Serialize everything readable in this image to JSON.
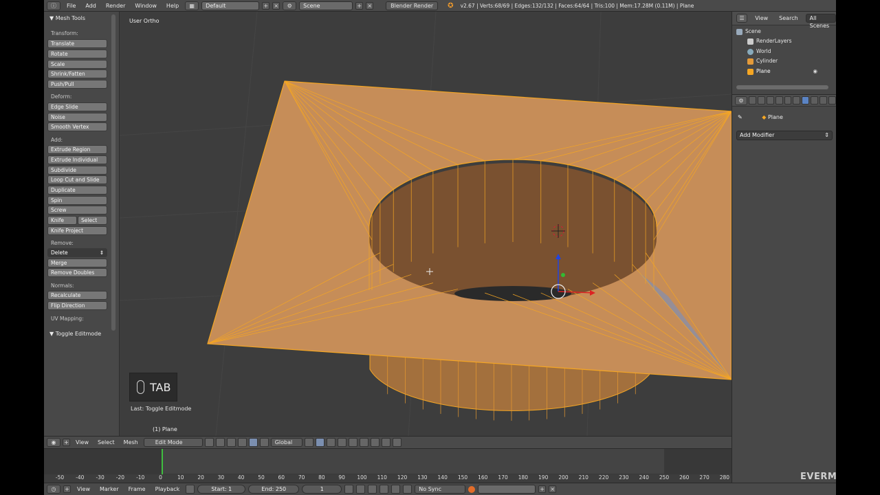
{
  "topbar": {
    "menus": [
      "File",
      "Add",
      "Render",
      "Window",
      "Help"
    ],
    "layout": "Default",
    "scene": "Scene",
    "engine": "Blender Render",
    "stats": "v2.67 | Verts:68/69 | Edges:132/132 | Faces:64/64 | Tris:100 | Mem:17.28M (0.11M) | Plane"
  },
  "toolshelf": {
    "title": "Mesh Tools",
    "sections": [
      {
        "label": "Transform:",
        "buttons": [
          "Translate",
          "Rotate",
          "Scale",
          "Shrink/Fatten",
          "Push/Pull"
        ]
      },
      {
        "label": "Deform:",
        "buttons": [
          "Edge Slide",
          "Noise",
          "Smooth Vertex"
        ]
      },
      {
        "label": "Add:",
        "buttons": [
          "Extrude Region",
          "Extrude Individual",
          "Subdivide",
          "Loop Cut and Slide",
          "Duplicate",
          "Spin",
          "Screw",
          "Knife",
          "Select",
          "Knife Project"
        ]
      },
      {
        "label": "Remove:",
        "buttons": [
          "Delete",
          "Merge",
          "Remove Doubles"
        ]
      },
      {
        "label": "Normals:",
        "buttons": [
          "Recalculate",
          "Flip Direction"
        ]
      },
      {
        "label": "UV Mapping:",
        "buttons": []
      }
    ],
    "toggle_panel": "Toggle Editmode"
  },
  "viewport": {
    "view_name": "User Ortho",
    "key_overlay": "TAB",
    "last_operator": "Last: Toggle Editmode",
    "object_label": "(1) Plane",
    "mesh_color": "#d79a60",
    "wire_color": "#f5a623"
  },
  "vp_header": {
    "menus": [
      "View",
      "Select",
      "Mesh"
    ],
    "mode": "Edit Mode",
    "orientation": "Global"
  },
  "timeline": {
    "ticks": [
      "-50",
      "-40",
      "-30",
      "-20",
      "-10",
      "0",
      "10",
      "20",
      "30",
      "40",
      "50",
      "60",
      "70",
      "80",
      "90",
      "100",
      "110",
      "120",
      "130",
      "140",
      "150",
      "160",
      "170",
      "180",
      "190",
      "200",
      "210",
      "220",
      "230",
      "240",
      "250",
      "260",
      "270",
      "280"
    ],
    "current_frame": 1
  },
  "tl_header": {
    "menus": [
      "View",
      "Marker",
      "Frame",
      "Playback"
    ],
    "start": "Start: 1",
    "end": "End: 250",
    "frame": "1",
    "sync": "No Sync"
  },
  "outliner": {
    "header_items": [
      "View",
      "Search",
      "All Scenes"
    ],
    "rows": [
      "Scene",
      "RenderLayers",
      "World",
      "Cylinder",
      "Plane"
    ]
  },
  "properties": {
    "object": "Plane",
    "add_modifier": "Add Modifier"
  },
  "watermark": "EVERMOTION"
}
